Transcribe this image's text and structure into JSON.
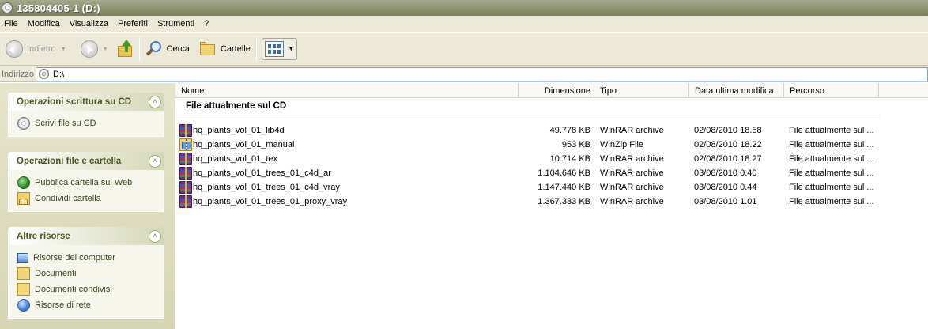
{
  "window": {
    "title": "135804405-1 (D:)",
    "cd_icon": "cd-drive-icon"
  },
  "menu": [
    "File",
    "Modifica",
    "Visualizza",
    "Preferiti",
    "Strumenti",
    "?"
  ],
  "toolbar": {
    "back_label": "Indietro",
    "search_label": "Cerca",
    "folders_label": "Cartelle"
  },
  "address": {
    "label": "Indirizzo",
    "path": "D:\\"
  },
  "tasks": {
    "cd": {
      "title": "Operazioni scrittura su CD",
      "items": [
        {
          "label": "Scrivi file su CD",
          "icon": "cd-write-icon"
        }
      ]
    },
    "file_folder": {
      "title": "Operazioni file e cartella",
      "items": [
        {
          "label": "Pubblica cartella sul Web",
          "icon": "publish-web-icon"
        },
        {
          "label": "Condividi cartella",
          "icon": "share-folder-icon"
        }
      ]
    },
    "other": {
      "title": "Altre risorse",
      "items": [
        {
          "label": "Risorse del computer",
          "icon": "my-computer-icon"
        },
        {
          "label": "Documenti",
          "icon": "documents-folder-icon"
        },
        {
          "label": "Documenti condivisi",
          "icon": "shared-documents-icon"
        },
        {
          "label": "Risorse di rete",
          "icon": "network-places-icon"
        }
      ]
    }
  },
  "columns": {
    "name": "Nome",
    "size": "Dimensione",
    "type": "Tipo",
    "modified": "Data ultima modifica",
    "path": "Percorso"
  },
  "group_header": "File attualmente sul CD",
  "files": [
    {
      "name": "hq_plants_vol_01_lib4d",
      "size": "49.778 KB",
      "type": "WinRAR archive",
      "modified": "02/08/2010 18.58",
      "path": "File attualmente sul ...",
      "icon": "winrar-archive-icon"
    },
    {
      "name": "hq_plants_vol_01_manual",
      "size": "953 KB",
      "type": "WinZip File",
      "modified": "02/08/2010 18.22",
      "path": "File attualmente sul ...",
      "icon": "winzip-file-icon"
    },
    {
      "name": "hq_plants_vol_01_tex",
      "size": "10.714 KB",
      "type": "WinRAR archive",
      "modified": "02/08/2010 18.27",
      "path": "File attualmente sul ...",
      "icon": "winrar-archive-icon"
    },
    {
      "name": "hq_plants_vol_01_trees_01_c4d_ar",
      "size": "1.104.646 KB",
      "type": "WinRAR archive",
      "modified": "03/08/2010 0.40",
      "path": "File attualmente sul ...",
      "icon": "winrar-archive-icon"
    },
    {
      "name": "hq_plants_vol_01_trees_01_c4d_vray",
      "size": "1.147.440 KB",
      "type": "WinRAR archive",
      "modified": "03/08/2010 0.44",
      "path": "File attualmente sul ...",
      "icon": "winrar-archive-icon"
    },
    {
      "name": "hq_plants_vol_01_trees_01_proxy_vray",
      "size": "1.367.333 KB",
      "type": "WinRAR archive",
      "modified": "03/08/2010 1.01",
      "path": "File attualmente sul ...",
      "icon": "winrar-archive-icon"
    }
  ]
}
